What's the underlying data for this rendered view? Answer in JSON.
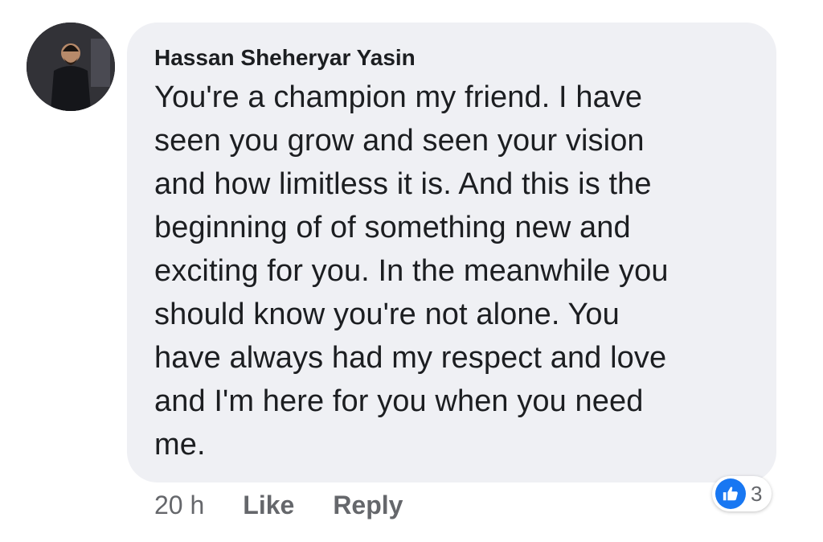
{
  "comment": {
    "author": "Hassan Sheheryar Yasin",
    "lines": [
      "You're a champion my friend. I have",
      "seen you grow and seen your vision",
      "and how limitless it is. And this is the",
      "beginning of of something new and",
      "exciting for you. In the meanwhile you",
      "should know you're not alone. You",
      "have always had my respect and love",
      "and I'm here for you when you need",
      "me."
    ],
    "time": "20 h",
    "like_label": "Like",
    "reply_label": "Reply",
    "reaction_count": "3",
    "reaction_icon": "thumbs-up-icon",
    "colors": {
      "bubble": "#eff0f4",
      "text": "#1c1e21",
      "meta": "#65676b",
      "like_blue": "#1877f2"
    }
  }
}
